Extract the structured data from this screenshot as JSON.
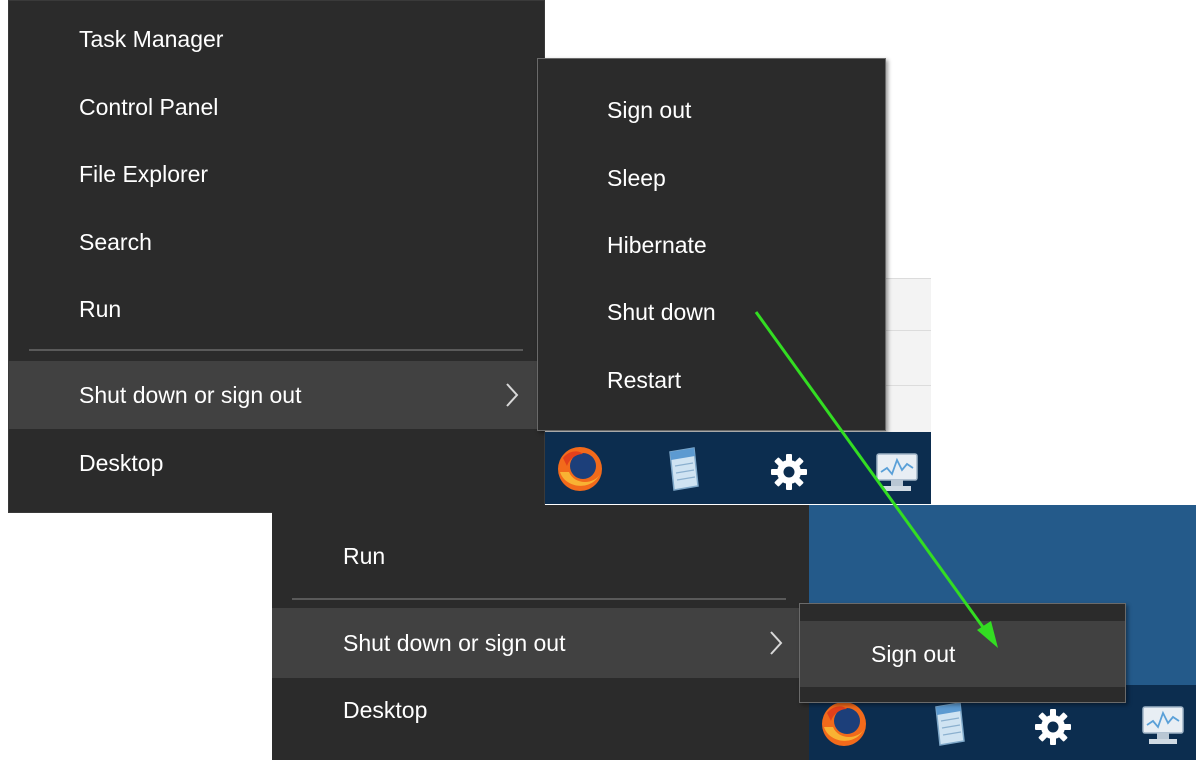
{
  "menu_top": {
    "items": [
      {
        "label": "Task Manager"
      },
      {
        "label": "Control Panel"
      },
      {
        "label": "File Explorer"
      },
      {
        "label": "Search"
      },
      {
        "label": "Run"
      },
      {
        "label": "Shut down or sign out"
      },
      {
        "label": "Desktop"
      }
    ]
  },
  "submenu_top": {
    "items": [
      {
        "label": "Sign out"
      },
      {
        "label": "Sleep"
      },
      {
        "label": "Hibernate"
      },
      {
        "label": "Shut down"
      },
      {
        "label": "Restart"
      }
    ]
  },
  "menu_bottom": {
    "items": [
      {
        "label": "Run"
      },
      {
        "label": "Shut down or sign out"
      },
      {
        "label": "Desktop"
      }
    ]
  },
  "submenu_bottom": {
    "items": [
      {
        "label": "Sign out"
      }
    ]
  },
  "taskbar_icons": [
    "firefox-icon",
    "notepad-icon",
    "gear-icon",
    "monitor-icon"
  ],
  "colors": {
    "menu_bg": "#2b2b2b",
    "highlight": "#414141",
    "taskbar": "#0c2d4f",
    "desktop": "#245a8a",
    "arrow": "#33dd22"
  }
}
